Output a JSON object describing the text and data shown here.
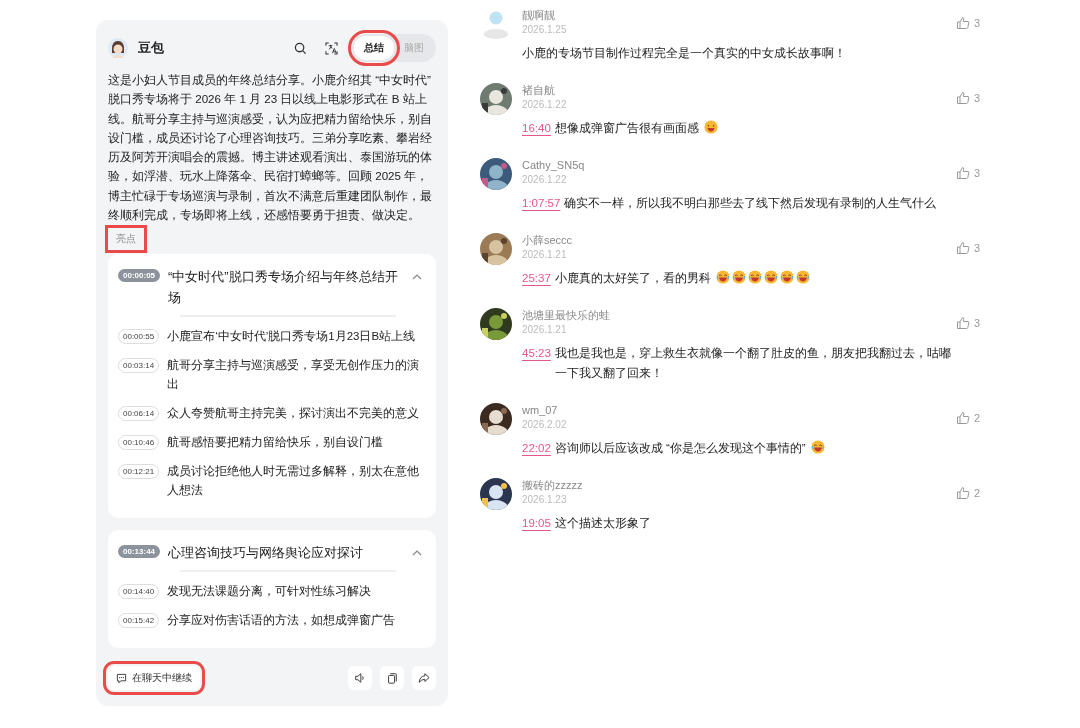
{
  "assistant": {
    "name": "豆包",
    "tabs": [
      {
        "label": "总结",
        "selected": true,
        "highlighted": true
      },
      {
        "label": "脑图",
        "selected": false,
        "highlighted": false
      }
    ]
  },
  "summary": "这是小妇人节目成员的年终总结分享。小鹿介绍其 “中女时代” 脱口秀专场将于 2026 年 1 月 23 日以线上电影形式在 B 站上线。航哥分享主持与巡演感受，认为应把精力留给快乐，别自设门槛，成员还讨论了心理咨询技巧。三弟分享吃素、攀岩经历及阿芳开演唱会的震撼。博主讲述观看演出、泰国游玩的体验，如浮潜、玩水上降落伞、民宿打蟑螂等。回顾 2025 年，博主忙碌于专场巡演与录制，首次不满意后重建团队制作，最终顺利完成，专场即将上线，还感悟要勇于担责、做决定。",
  "highlights_label": {
    "text": "亮点",
    "highlighted": true
  },
  "sections": [
    {
      "time": "00:00:05",
      "title": "“中女时代”脱口秀专场介绍与年终总结开场",
      "expanded": true,
      "items": [
        {
          "time": "00:00:55",
          "text": "小鹿宣布‘中女时代’脱口秀专场1月23日B站上线"
        },
        {
          "time": "00:03:14",
          "text": "航哥分享主持与巡演感受，享受无创作压力的演出"
        },
        {
          "time": "00:06:14",
          "text": "众人夸赞航哥主持完美，探讨演出不完美的意义"
        },
        {
          "time": "00:10:46",
          "text": "航哥感悟要把精力留给快乐，别自设门槛"
        },
        {
          "time": "00:12:21",
          "text": "成员讨论拒绝他人时无需过多解释，别太在意他人想法"
        }
      ]
    },
    {
      "time": "00:13:44",
      "title": "心理咨询技巧与网络舆论应对探讨",
      "expanded": true,
      "items": [
        {
          "time": "00:14:40",
          "text": "发现无法课题分离，可针对性练习解决"
        },
        {
          "time": "00:15:42",
          "text": "分享应对伤害话语的方法，如想成弹窗广告"
        }
      ]
    }
  ],
  "continue_button": {
    "label": "在聊天中继续",
    "highlighted": true
  },
  "comments": [
    {
      "avatar": {
        "kind": "silhouette"
      },
      "user": "靓啊靓",
      "date": "2026.1.25",
      "text": "小鹿的专场节目制作过程完全是一个真实的中女成长故事啊！",
      "likes": "3"
    },
    {
      "avatar": {
        "kind": "picture"
      },
      "user": "褚自航",
      "date": "2026.1.22",
      "timestamp": "16:40",
      "text": "想像成弹窗广告很有画面感",
      "likes": "3",
      "emojis": [
        {
          "kind": "grin"
        }
      ]
    },
    {
      "avatar": {
        "kind": "picture"
      },
      "user": "Cathy_SN5q",
      "date": "2026.1.22",
      "timestamp": "1:07:57",
      "text": "确实不一样，所以我不明白那些去了线下然后发现有录制的人生气什么",
      "likes": "3"
    },
    {
      "avatar": {
        "kind": "picture"
      },
      "user": "小薛seccc",
      "date": "2026.1.21",
      "timestamp": "25:37",
      "text": "小鹿真的太好笑了，看的男科",
      "likes": "3",
      "emojis": [
        {
          "kind": "laugh"
        },
        {
          "kind": "laugh"
        },
        {
          "kind": "laugh"
        },
        {
          "kind": "laugh"
        },
        {
          "kind": "laugh"
        },
        {
          "kind": "laugh"
        }
      ]
    },
    {
      "avatar": {
        "kind": "picture"
      },
      "user": "池塘里最快乐的蛙",
      "date": "2026.1.21",
      "timestamp": "45:23",
      "text": "我也是我也是，穿上救生衣就像一个翻了肚皮的鱼，朋友把我翻过去，咕嘟一下我又翻了回来！",
      "likes": "3"
    },
    {
      "avatar": {
        "kind": "picture"
      },
      "user": "wm_07",
      "date": "2026.2.02",
      "timestamp": "22:02",
      "text": "咨询师以后应该改成 “你是怎么发现这个事情的”",
      "likes": "2",
      "emojis": [
        {
          "kind": "laugh"
        }
      ]
    },
    {
      "avatar": {
        "kind": "picture"
      },
      "user": "搬砖的zzzzz",
      "date": "2026.1.23",
      "timestamp": "19:05",
      "text": "这个描述太形象了",
      "likes": "2"
    }
  ]
}
